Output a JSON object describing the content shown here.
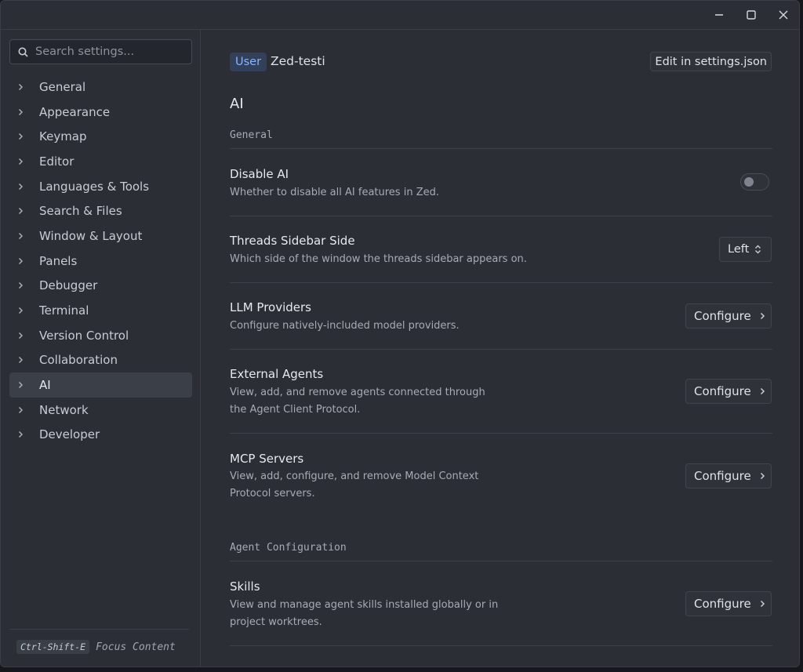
{
  "window": {
    "minimize_icon": "minimize-icon",
    "maximize_icon": "maximize-icon",
    "close_icon": "close-icon"
  },
  "sidebar": {
    "search_placeholder": "Search settings...",
    "items": [
      {
        "label": "General"
      },
      {
        "label": "Appearance"
      },
      {
        "label": "Keymap"
      },
      {
        "label": "Editor"
      },
      {
        "label": "Languages & Tools"
      },
      {
        "label": "Search & Files"
      },
      {
        "label": "Window & Layout"
      },
      {
        "label": "Panels"
      },
      {
        "label": "Debugger"
      },
      {
        "label": "Terminal"
      },
      {
        "label": "Version Control"
      },
      {
        "label": "Collaboration"
      },
      {
        "label": "AI"
      },
      {
        "label": "Network"
      },
      {
        "label": "Developer"
      }
    ],
    "active_item": "AI",
    "footer": {
      "shortcut": "Ctrl-Shift-E",
      "label": "Focus Content"
    }
  },
  "header": {
    "scope_chip": "User",
    "profile": "Zed-testi",
    "edit_button": "Edit in settings.json"
  },
  "page": {
    "title": "AI",
    "sections": [
      {
        "heading": "General"
      },
      {
        "heading": "Agent Configuration"
      }
    ],
    "rows": [
      {
        "title": "Disable AI",
        "description": "Whether to disable all AI features in Zed.",
        "control": "toggle",
        "value": "off"
      },
      {
        "title": "Threads Sidebar Side",
        "description": "Which side of the window the threads sidebar appears on.",
        "control": "dropdown",
        "value": "Left"
      },
      {
        "title": "LLM Providers",
        "description": "Configure natively-included model providers.",
        "control": "button",
        "button_label": "Configure"
      },
      {
        "title": "External Agents",
        "description": "View, add, and remove agents connected through the Agent Client Protocol.",
        "control": "button",
        "button_label": "Configure"
      },
      {
        "title": "MCP Servers",
        "description": "View, add, configure, and remove Model Context Protocol servers.",
        "control": "button",
        "button_label": "Configure"
      },
      {
        "title": "Skills",
        "description": "View and manage agent skills installed globally or in project worktrees.",
        "control": "button",
        "button_label": "Configure"
      }
    ]
  },
  "colors": {
    "background": "#2b2e35",
    "accent": "#89b4fa",
    "active_item_bg": "#3b3f47"
  }
}
